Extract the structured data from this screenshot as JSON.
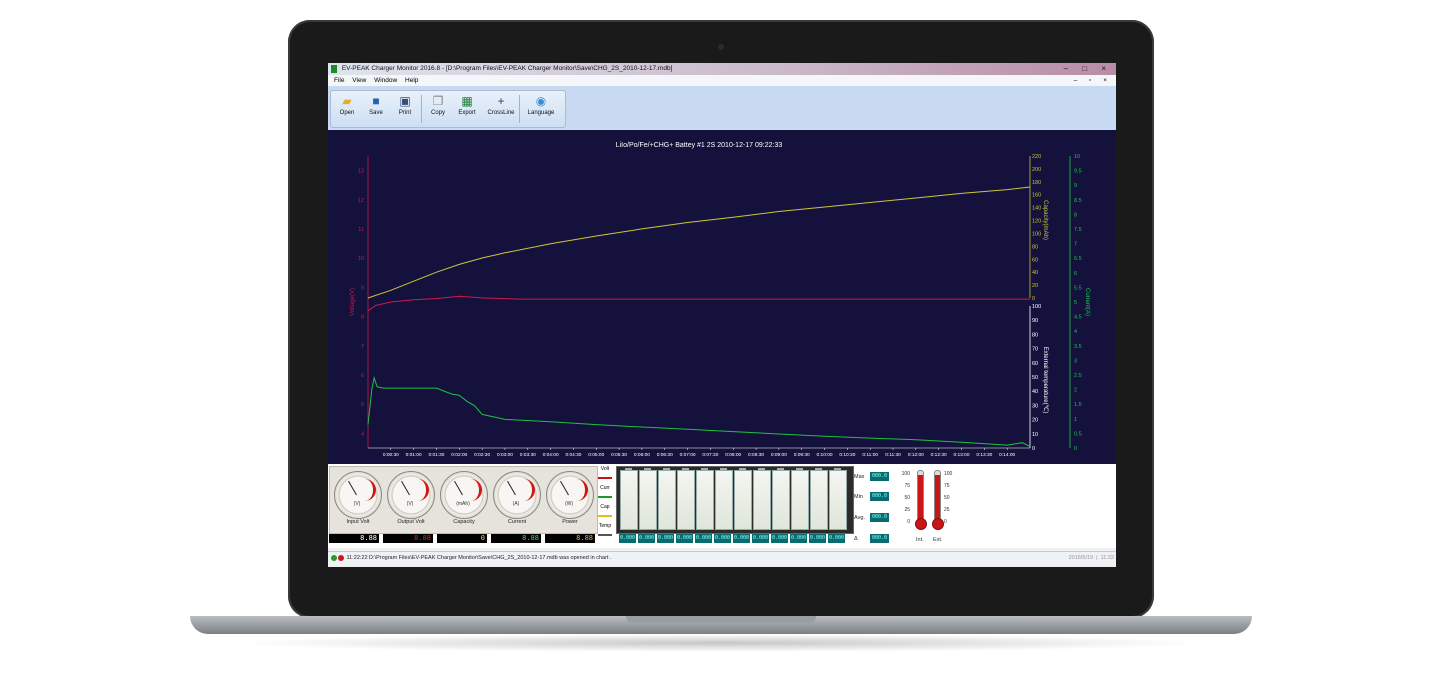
{
  "window": {
    "title": "EV-PEAK Charger Monitor 2016.8 - [D:\\Program Files\\EV-PEAK Charger Monitor\\Save\\CHG_2S_2010-12-17.mdb]",
    "controls": "– □ ×"
  },
  "menu": {
    "items": [
      "File",
      "View",
      "Window",
      "Help"
    ],
    "mdi_controls": "– ▫ ×"
  },
  "toolbar": {
    "buttons": [
      {
        "label": "Open",
        "icon": "folder-icon"
      },
      {
        "label": "Save",
        "icon": "floppy-disk-icon"
      },
      {
        "label": "Print",
        "icon": "printer-icon"
      },
      {
        "label": "Copy",
        "icon": "copy-icon"
      },
      {
        "label": "Export",
        "icon": "export-excel-icon"
      },
      {
        "label": "CrossLine",
        "icon": "crossline-icon"
      },
      {
        "label": "Language",
        "icon": "globe-icon"
      }
    ]
  },
  "chart_data": {
    "type": "line",
    "title": "LiIo/Po/Fe/+CHG+ Battey #1 2S  2010-12-17  09:22:33",
    "xlabel": "",
    "x_ticks": [
      "0:00:30",
      "0:01:00",
      "0:01:30",
      "0:02:00",
      "0:02:30",
      "0:03:00",
      "0:03:30",
      "0:04:00",
      "0:04:30",
      "0:05:00",
      "0:05:30",
      "0:06:00",
      "0:06:30",
      "0:07:00",
      "0:07:30",
      "0:08:00",
      "0:08:30",
      "0:09:00",
      "0:09:30",
      "0:10:00",
      "0:10:30",
      "0:11:00",
      "0:11:30",
      "0:12:00",
      "0:12:30",
      "0:13:00",
      "0:13:30",
      "0:14:00"
    ],
    "xlim_seconds": [
      0,
      870
    ],
    "axes": {
      "voltage": {
        "label": "Voltage(V)",
        "ticks": [
          "4",
          "5",
          "6",
          "7",
          "8",
          "9",
          "10",
          "11",
          "12",
          "13"
        ],
        "ylim": [
          3.5,
          13.5
        ],
        "color": "#c8184a"
      },
      "capacity": {
        "label": "Capacity(mAh)",
        "ticks": [
          "0",
          "20",
          "40",
          "60",
          "80",
          "100",
          "120",
          "140",
          "160",
          "180",
          "200",
          "220"
        ],
        "ylim": [
          0,
          220
        ],
        "color": "#c9c23a"
      },
      "temperature": {
        "label": "External temperature(℃)",
        "ticks": [
          "0",
          "10",
          "20",
          "30",
          "40",
          "50",
          "60",
          "70",
          "80",
          "90",
          "100"
        ],
        "ylim": [
          0,
          100
        ],
        "color": "#ffffff"
      },
      "current": {
        "label": "Current(A)",
        "ticks": [
          "0",
          "0.5",
          "1",
          "1.5",
          "2",
          "2.5",
          "3",
          "3.5",
          "4",
          "4.5",
          "5",
          "5.5",
          "6",
          "6.5",
          "7",
          "7.5",
          "8",
          "8.5",
          "9",
          "9.5",
          "10"
        ],
        "ylim": [
          0,
          10
        ],
        "color": "#19c34a"
      }
    },
    "series": [
      {
        "name": "Volt",
        "axis": "voltage",
        "color": "#d0184a",
        "x": [
          0,
          10,
          30,
          60,
          90,
          120,
          150,
          200,
          300,
          400,
          500,
          600,
          700,
          800,
          870
        ],
        "y": [
          8.2,
          8.38,
          8.5,
          8.58,
          8.62,
          8.7,
          8.64,
          8.6,
          8.6,
          8.6,
          8.6,
          8.6,
          8.6,
          8.6,
          8.6
        ]
      },
      {
        "name": "Cap",
        "axis": "capacity",
        "color": "#cfc53a",
        "x": [
          0,
          30,
          60,
          90,
          120,
          150,
          180,
          240,
          300,
          360,
          420,
          480,
          540,
          600,
          660,
          720,
          780,
          840,
          870
        ],
        "y": [
          0,
          12,
          26,
          40,
          52,
          62,
          70,
          84,
          96,
          107,
          117,
          125,
          134,
          141,
          148,
          155,
          162,
          168,
          172
        ]
      },
      {
        "name": "Curr",
        "axis": "current",
        "color": "#20c040",
        "x": [
          0,
          5,
          8,
          12,
          20,
          60,
          90,
          100,
          110,
          120,
          130,
          140,
          150,
          180,
          240,
          300,
          360,
          420,
          480,
          540,
          600,
          660,
          720,
          780,
          840,
          860,
          870
        ],
        "y": [
          0.8,
          2.0,
          2.4,
          2.1,
          2.05,
          2.05,
          2.05,
          1.95,
          1.85,
          1.8,
          1.6,
          1.45,
          1.15,
          0.98,
          0.9,
          0.8,
          0.72,
          0.64,
          0.56,
          0.48,
          0.4,
          0.34,
          0.28,
          0.2,
          0.1,
          0.18,
          0.05
        ]
      }
    ],
    "grid": false,
    "background": "#14123d"
  },
  "gauges": [
    {
      "label": "Input Volt",
      "unit": "(V)"
    },
    {
      "label": "Output Volt",
      "unit": "(V)"
    },
    {
      "label": "Capacity",
      "unit": "(mAh)"
    },
    {
      "label": "Current",
      "unit": "(A)"
    },
    {
      "label": "Power",
      "unit": "(W)"
    }
  ],
  "gauge_legend": [
    "Volt",
    "Curr",
    "Cap",
    "Temp"
  ],
  "readouts": [
    {
      "value": "8.88",
      "color": "#ffffff"
    },
    {
      "value": "8.88",
      "color": "#e02020"
    },
    {
      "value": "0",
      "color": "#f0e020"
    },
    {
      "value": "8.88",
      "color": "#20e040"
    },
    {
      "value": "8.88",
      "color": "#f0a020"
    }
  ],
  "cell_readout": "0.000",
  "stats": [
    {
      "label": "Max",
      "value": "000.0"
    },
    {
      "label": "Min",
      "value": "000.0"
    },
    {
      "label": "Avg.",
      "value": "000.0"
    },
    {
      "label": "Δ",
      "value": "000.0"
    }
  ],
  "thermometers": {
    "scale": [
      "100",
      "75",
      "50",
      "25",
      "0"
    ],
    "labels": [
      "Int.",
      "Ext."
    ]
  },
  "status": {
    "message": "11:22:22  D:\\Program Files\\EV-PEAK Charger Monitor\\Save\\CHG_2S_2010-12-17.mdb was opened in chart .",
    "date": "2018/6/19",
    "time": "11:22"
  }
}
